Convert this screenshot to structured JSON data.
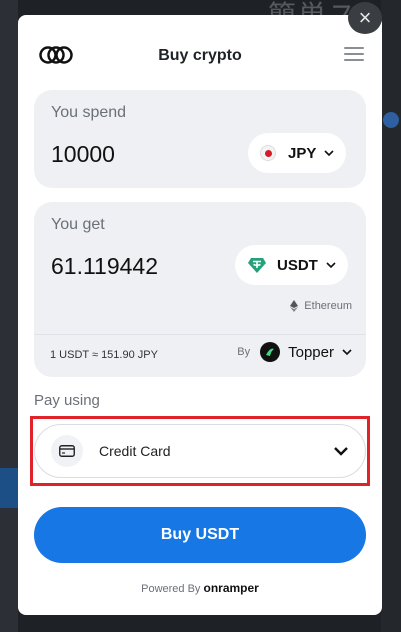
{
  "background": {
    "title": "簡単ス"
  },
  "widget": {
    "close_glyph": "×",
    "title": "Buy crypto",
    "spend": {
      "label": "You spend",
      "amount": "10000",
      "currency": "JPY"
    },
    "get": {
      "label": "You get",
      "amount": "61.119442",
      "currency": "USDT",
      "network": "Ethereum",
      "rate": "1 USDT ≈ 151.90 JPY",
      "provider_by": "By",
      "provider_name": "Topper"
    },
    "pay": {
      "label": "Pay using",
      "method": "Credit Card"
    },
    "buy_button": "Buy USDT",
    "powered_by": "Powered By",
    "brand": "onramper"
  },
  "colors": {
    "accent": "#1677e5",
    "highlight": "#e0222b",
    "tether": "#26a17b"
  },
  "icons": [
    "onramper-logo-icon",
    "menu-icon",
    "japan-flag-icon",
    "tether-icon",
    "ethereum-icon",
    "topper-logo-icon",
    "credit-card-icon",
    "chevron-down-icon",
    "close-icon"
  ]
}
